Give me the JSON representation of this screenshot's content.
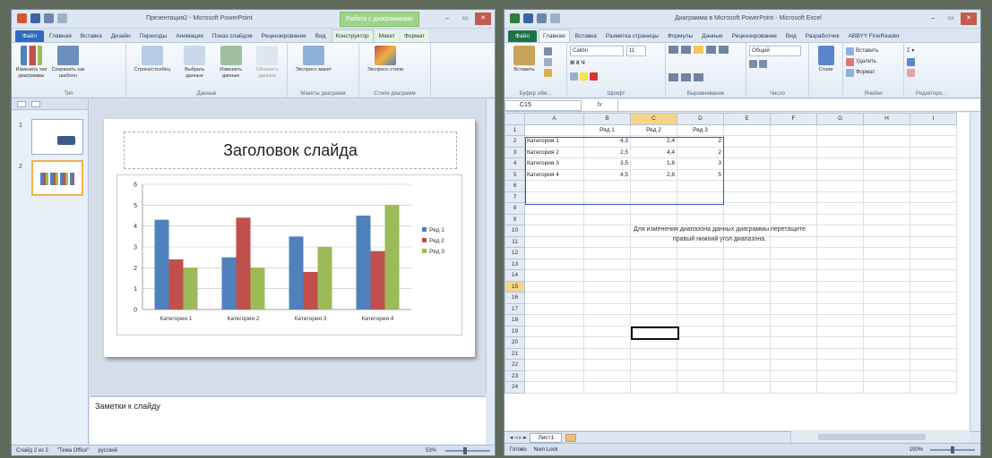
{
  "ppt": {
    "title": "Презентация2 - Microsoft PowerPoint",
    "context_tab": "Работа с диаграммами",
    "tabs": [
      "Файл",
      "Главная",
      "Вставка",
      "Дизайн",
      "Переходы",
      "Анимация",
      "Показ слайдов",
      "Рецензирование",
      "Вид",
      "Конструктор",
      "Макет",
      "Формат"
    ],
    "ribbon": {
      "change_type": "Изменить тип диаграммы",
      "save_template": "Сохранить как шаблон",
      "group_type": "Тип",
      "row_col": "Строка/столбец",
      "select_data": "Выбрать данные",
      "edit_data": "Изменить данные",
      "refresh_data": "Обновить данные",
      "group_data": "Данные",
      "quick_layout": "Экспресс-макет",
      "group_layouts": "Макеты диаграмм",
      "quick_styles": "Экспресс-стили",
      "group_styles": "Стили диаграмм"
    },
    "thumbs": [
      "1",
      "2"
    ],
    "slide_title": "Заголовок слайда",
    "notes": "Заметки к слайду",
    "status": {
      "slide": "Слайд 2 из 2",
      "theme": "\"Тема Office\"",
      "lang": "русский",
      "zoom": "53%"
    }
  },
  "chart_data": {
    "type": "bar",
    "categories": [
      "Категория 1",
      "Категория 2",
      "Категория 3",
      "Категория 4"
    ],
    "series": [
      {
        "name": "Ряд 1",
        "values": [
          4.3,
          2.5,
          3.5,
          4.5
        ],
        "color": "#4f81bd"
      },
      {
        "name": "Ряд 2",
        "values": [
          2.4,
          4.4,
          1.8,
          2.8
        ],
        "color": "#c0504d"
      },
      {
        "name": "Ряд 3",
        "values": [
          2,
          2,
          3,
          5
        ],
        "color": "#9bbb59"
      }
    ],
    "ylim": [
      0,
      6
    ],
    "yticks": [
      "0",
      "1",
      "2",
      "3",
      "4",
      "5",
      "6"
    ],
    "grid": true,
    "legend": "right"
  },
  "xl": {
    "title": "Диаграмма в Microsoft PowerPoint - Microsoft Excel",
    "tabs": [
      "Файл",
      "Главная",
      "Вставка",
      "Разметка страницы",
      "Формулы",
      "Данные",
      "Рецензирование",
      "Вид",
      "Разработчик",
      "ABBYY FineReader"
    ],
    "ribbon": {
      "paste": "Вставить",
      "group_clipboard": "Буфер обм...",
      "font_name": "Calibri",
      "font_size": "11",
      "group_font": "Шрифт",
      "group_align": "Выравнивание",
      "number_format": "Общий",
      "group_number": "Число",
      "styles": "Стили",
      "insert": "Вставить",
      "delete": "Удалить",
      "format": "Формат",
      "group_cells": "Ячейки",
      "group_edit": "Редактиро..."
    },
    "namebox": "C15",
    "fx": "fx",
    "columns": [
      "A",
      "B",
      "C",
      "D",
      "E",
      "F",
      "G",
      "H",
      "I"
    ],
    "header_row": [
      "",
      "Ряд 1",
      "Ряд 2",
      "Ряд 3"
    ],
    "rows": [
      [
        "Категория 1",
        "4,3",
        "2,4",
        "2"
      ],
      [
        "Категория 2",
        "2,5",
        "4,4",
        "2"
      ],
      [
        "Категория 3",
        "3,5",
        "1,8",
        "3"
      ],
      [
        "Категория 4",
        "4,5",
        "2,8",
        "5"
      ]
    ],
    "hint_line1": "Для изменения диапазона данных диаграммы перетащите",
    "hint_line2": "правый нижний угол диапазона.",
    "sheet_tab": "Лист1",
    "status": {
      "ready": "Готово",
      "numlock": "Num Lock",
      "zoom": "100%"
    }
  }
}
